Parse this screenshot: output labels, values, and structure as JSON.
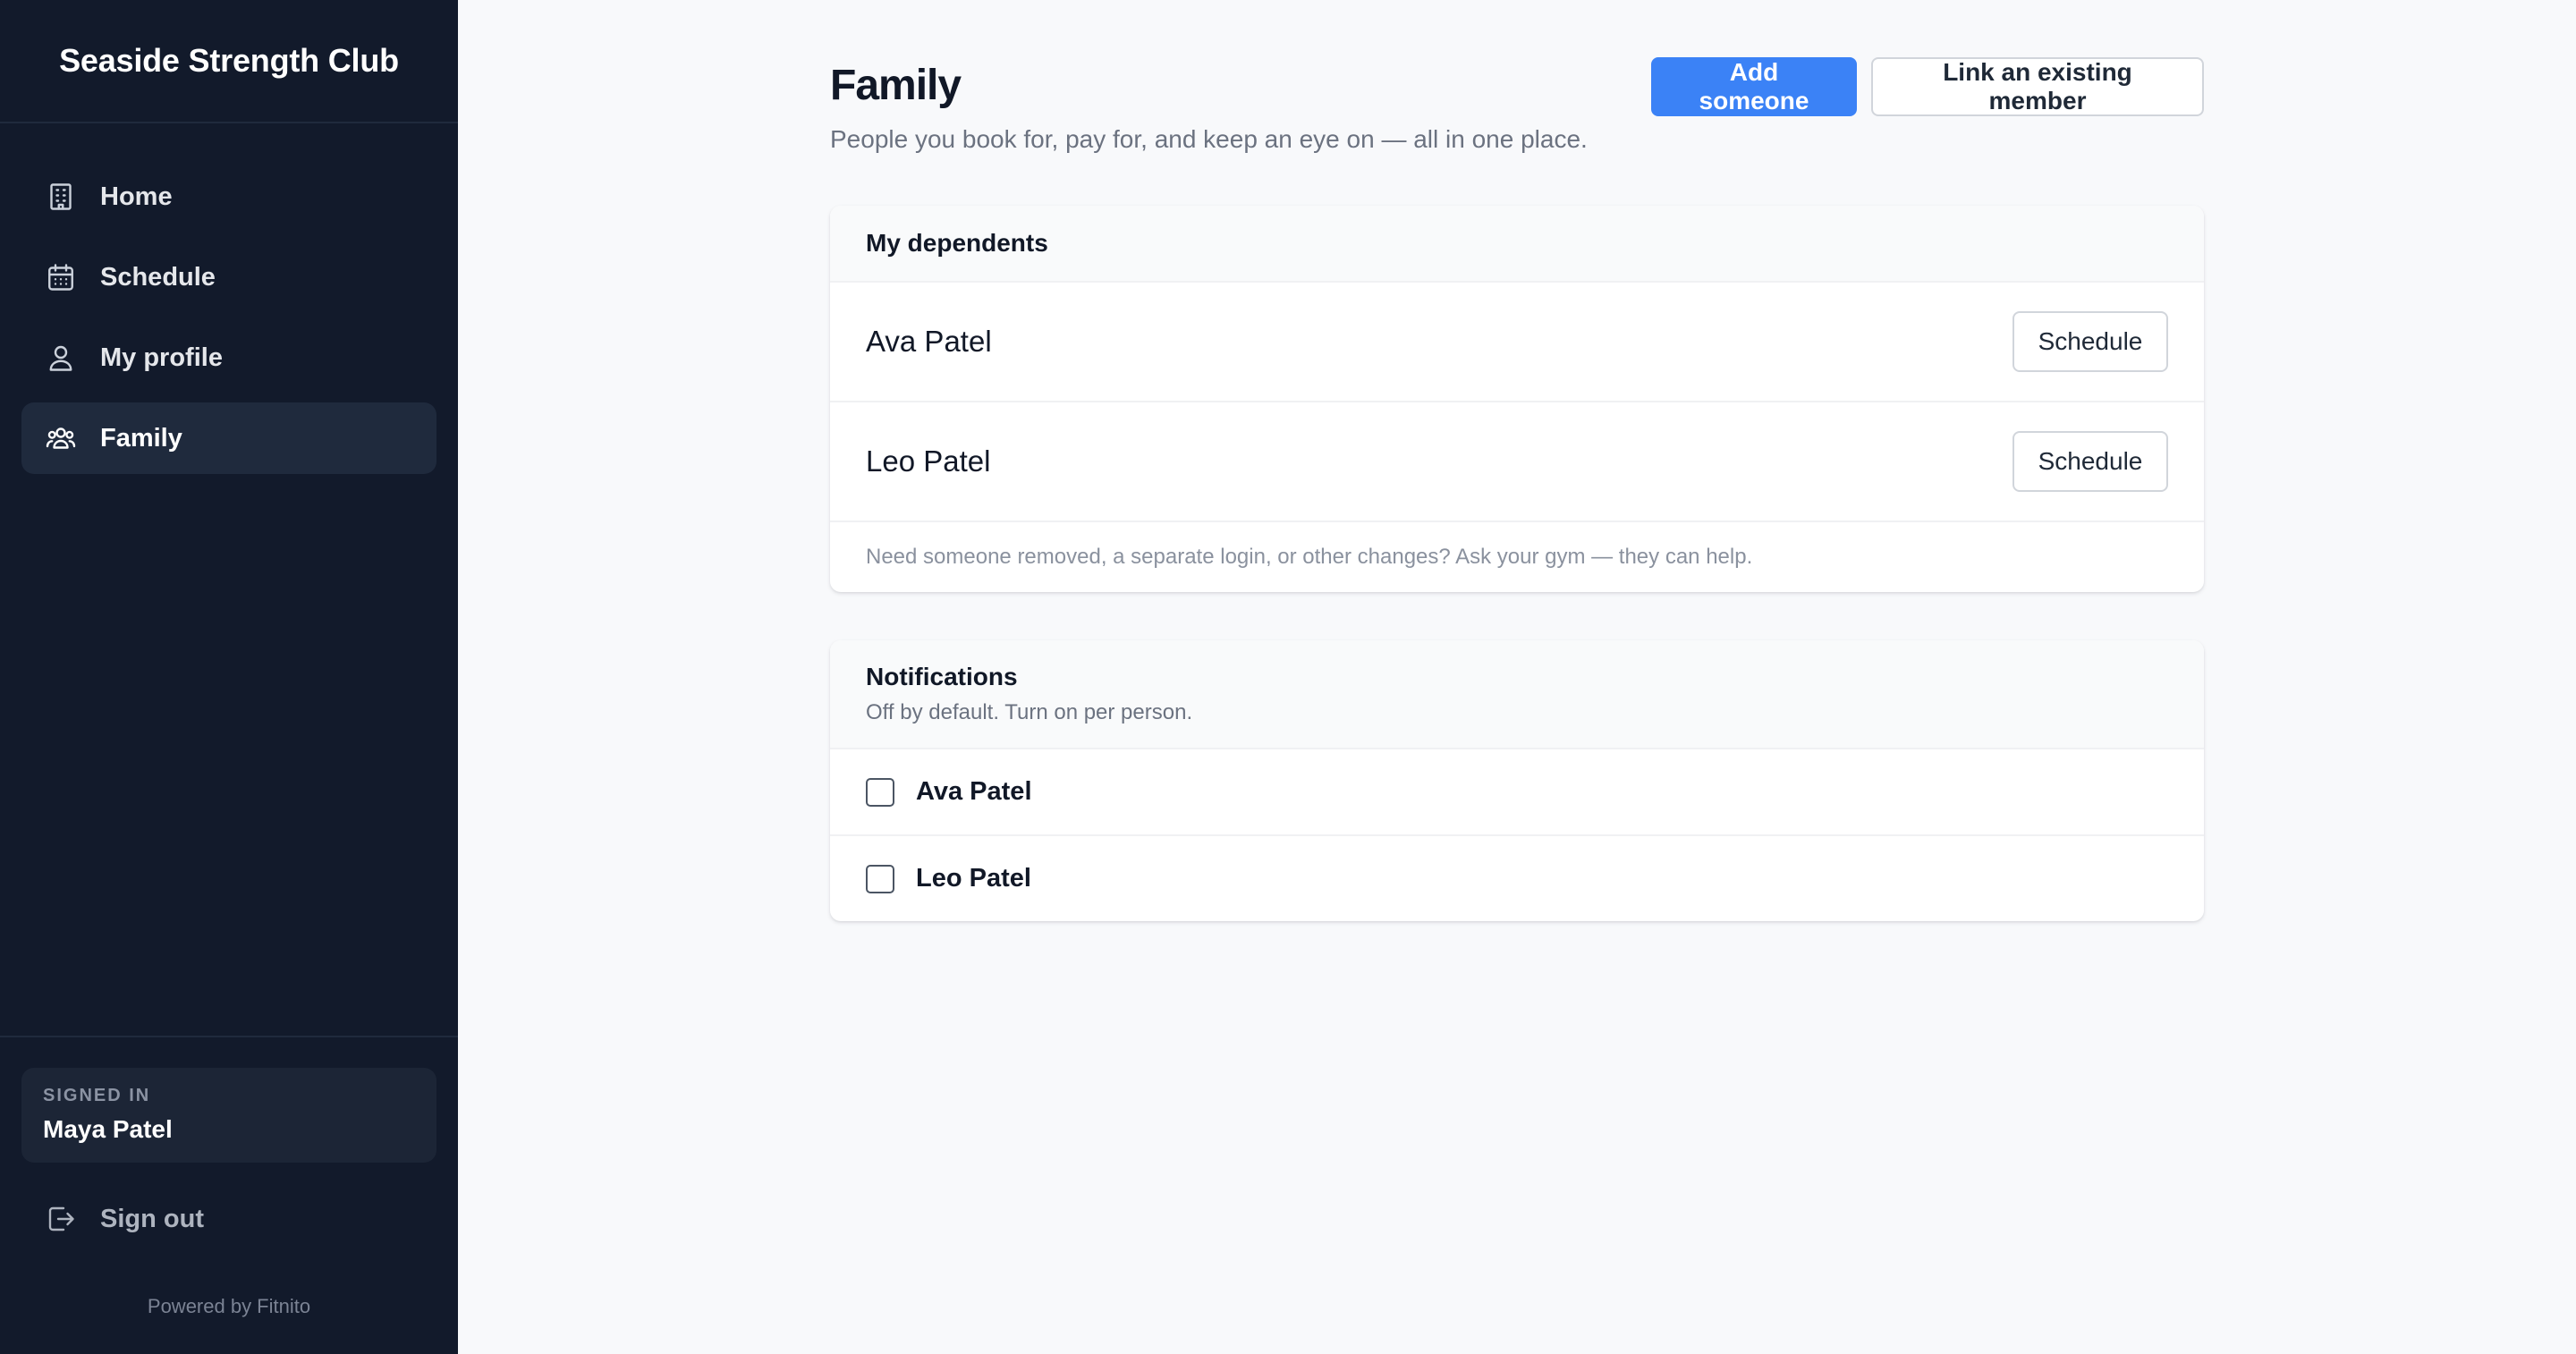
{
  "app": {
    "brand": "Seaside Strength Club",
    "powered_by": "Powered by Fitnito"
  },
  "sidebar": {
    "items": [
      {
        "label": "Home",
        "icon": "building-icon",
        "active": false
      },
      {
        "label": "Schedule",
        "icon": "calendar-icon",
        "active": false
      },
      {
        "label": "My profile",
        "icon": "user-icon",
        "active": false
      },
      {
        "label": "Family",
        "icon": "users-icon",
        "active": true
      }
    ],
    "signed_in_label": "SIGNED IN",
    "signed_in_name": "Maya Patel",
    "signout_label": "Sign out"
  },
  "header": {
    "title": "Family",
    "subtitle": "People you book for, pay for, and keep an eye on — all in one place.",
    "add_label": "Add someone",
    "link_label": "Link an existing member"
  },
  "dependents": {
    "title": "My dependents",
    "items": [
      {
        "name": "Ava Patel",
        "action": "Schedule"
      },
      {
        "name": "Leo Patel",
        "action": "Schedule"
      }
    ],
    "note": "Need someone removed, a separate login, or other changes? Ask your gym — they can help."
  },
  "notifications": {
    "title": "Notifications",
    "subtitle": "Off by default. Turn on per person.",
    "items": [
      {
        "name": "Ava Patel",
        "checked": false
      },
      {
        "name": "Leo Patel",
        "checked": false
      }
    ]
  },
  "colors": {
    "sidebar_bg": "#121a2b",
    "accent": "#3b82f6",
    "page_bg": "#f8f9fb"
  }
}
